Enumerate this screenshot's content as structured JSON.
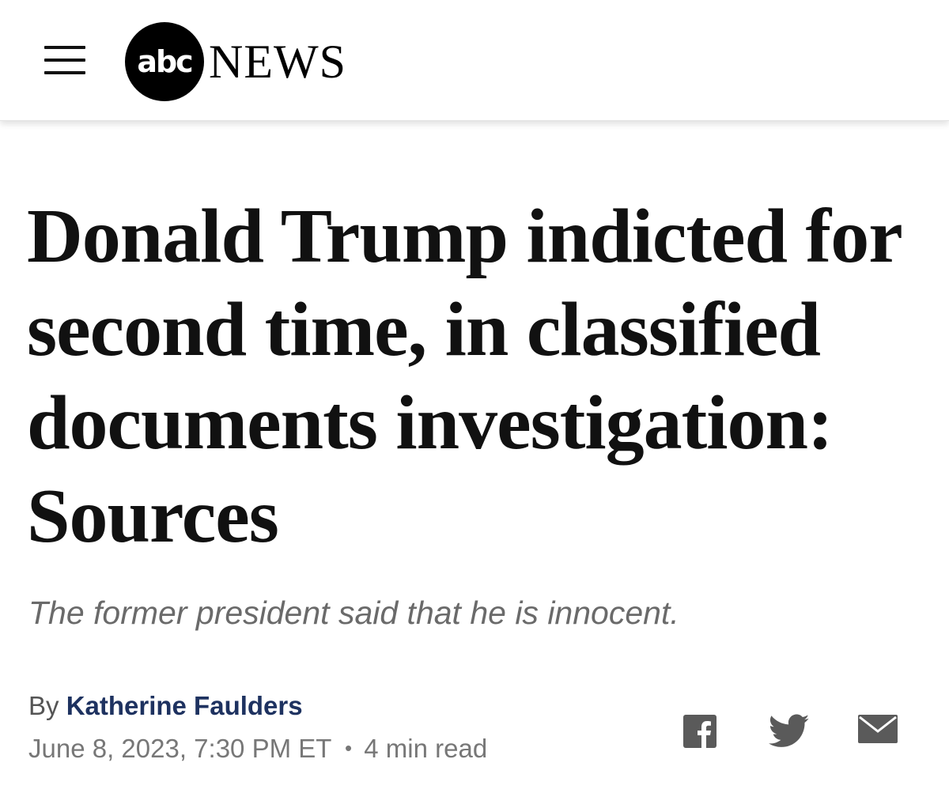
{
  "header": {
    "logo_abc": "abc",
    "logo_news": "NEWS",
    "menu_icon": "hamburger-menu-icon"
  },
  "article": {
    "headline": "Donald Trump indicted for second time, in classified documents investigation: Sources",
    "subtitle": "The former president said that he is innocent.",
    "byline_prefix": "By",
    "author": "Katherine Faulders",
    "date": "June 8, 2023, 7:30 PM ET",
    "separator": "•",
    "read_time": "4 min read"
  },
  "share": {
    "icons": [
      "facebook-icon",
      "twitter-icon",
      "email-icon"
    ]
  },
  "colors": {
    "author_link": "#1e3260",
    "subtitle": "#6a6a6a",
    "share_icons": "#5a5a5a"
  }
}
